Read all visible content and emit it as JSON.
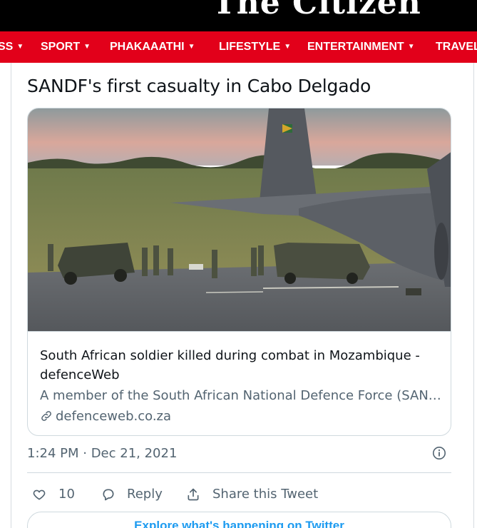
{
  "site": {
    "logo_text": "The Citizen"
  },
  "nav": {
    "items": [
      {
        "label": "SS"
      },
      {
        "label": "SPORT"
      },
      {
        "label": "PHAKAAATHI"
      },
      {
        "label": "LIFESTYLE"
      },
      {
        "label": "ENTERTAINMENT"
      },
      {
        "label": "TRAVEL"
      }
    ]
  },
  "tweet": {
    "text": "SANDF's first casualty in Cabo Delgado",
    "link_card": {
      "title": "South African soldier killed during combat in Mozambique - defenceWeb",
      "description": "A member of the South African National Defence Force (SANDF) has been killed",
      "domain": "defenceweb.co.za"
    },
    "timestamp": "1:24 PM · Dec 21, 2021",
    "actions": {
      "like_count": "10",
      "reply_label": "Reply",
      "share_label": "Share this Tweet"
    },
    "explore_label": "Explore what's happening on Twitter"
  },
  "colors": {
    "nav_bg": "#e2001a",
    "masthead_bg": "#000000",
    "link_blue": "#1d9bf0",
    "secondary_text": "#536471"
  },
  "icons": {
    "caret": "caret-down-icon",
    "link": "link-icon",
    "info": "info-icon",
    "like": "heart-icon",
    "reply": "reply-bubble-icon",
    "share": "share-upload-icon"
  }
}
